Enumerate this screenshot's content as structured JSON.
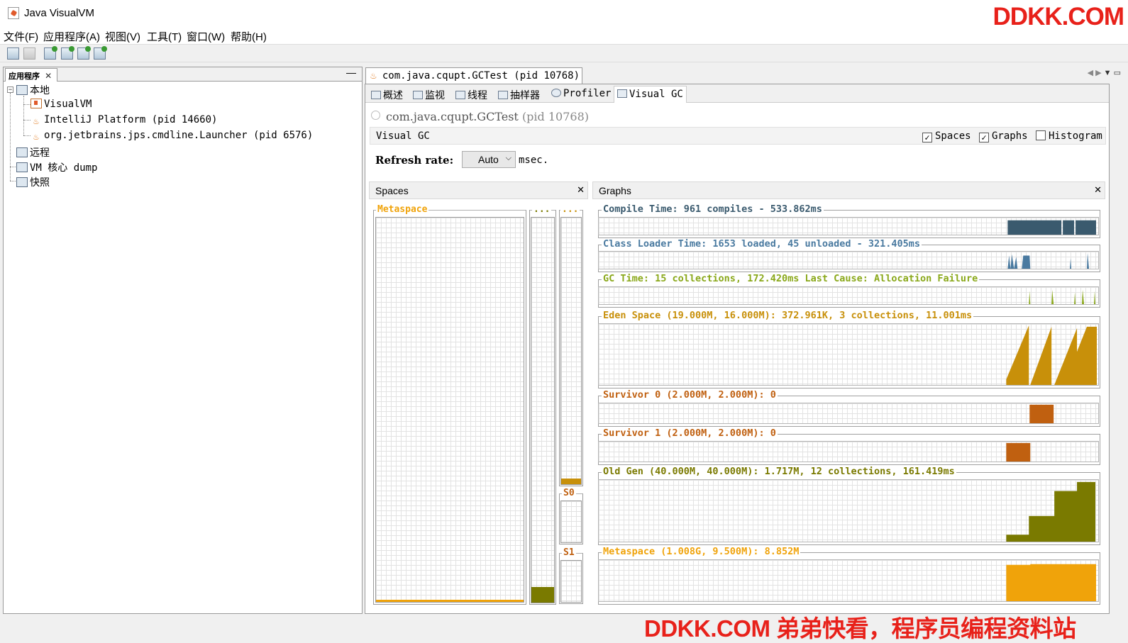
{
  "window": {
    "title": "Java VisualVM"
  },
  "watermark": {
    "top": "DDKK.COM",
    "bottom": "DDKK.COM 弟弟快看，程序员编程资料站"
  },
  "menu": [
    "文件(F)",
    "应用程序(A)",
    "视图(V)",
    "工具(T)",
    "窗口(W)",
    "帮助(H)"
  ],
  "left_panel": {
    "tab_label": "应用程序",
    "tree": {
      "local": "本地",
      "local_children": [
        "VisualVM",
        "IntelliJ Platform (pid 14660)",
        "org.jetbrains.jps.cmdline.Launcher (pid 6576)"
      ],
      "remote": "远程",
      "vm_dump": "VM 核心 dump",
      "snapshots": "快照"
    }
  },
  "document_tab": {
    "label": "com.java.cqupt.GCTest (pid 10768)"
  },
  "subtabs": [
    "概述",
    "监视",
    "线程",
    "抽样器",
    "Profiler",
    "Visual GC"
  ],
  "visual_gc": {
    "process_name": "com.java.cqupt.GCTest",
    "process_pid": "(pid 10768)",
    "bar_label": "Visual GC",
    "options": [
      {
        "label": "Spaces",
        "checked": true
      },
      {
        "label": "Graphs",
        "checked": true
      },
      {
        "label": "Histogram",
        "checked": false
      }
    ],
    "check_mark": "✓",
    "refresh_label": "Refresh rate:",
    "refresh_value": "Auto",
    "refresh_unit": "msec."
  },
  "spaces_pane": {
    "title": "Spaces",
    "metaspace_label": "Metaspace",
    "col2_label": "...",
    "col3_label": "...",
    "s0_label": "S0",
    "s1_label": "S1",
    "colors": {
      "meta": "#f0a30a",
      "old": "#7a7a00",
      "eden": "#c8900a"
    }
  },
  "graphs_pane": {
    "title": "Graphs",
    "graphs": [
      {
        "title": "Compile Time: 961 compiles - 533.862ms",
        "color": "#3a5a6e"
      },
      {
        "title": "Class Loader Time: 1653 loaded, 45 unloaded - 321.405ms",
        "color": "#4a7aa0"
      },
      {
        "title": "GC Time: 15 collections, 172.420ms Last Cause: Allocation Failure",
        "color": "#8aa81a"
      },
      {
        "title": "Eden Space (19.000M, 16.000M): 372.961K, 3 collections, 11.001ms",
        "color": "#c8900a"
      },
      {
        "title": "Survivor 0 (2.000M, 2.000M): 0",
        "color": "#c06010"
      },
      {
        "title": "Survivor 1 (2.000M, 2.000M): 0",
        "color": "#c06010"
      },
      {
        "title": "Old Gen (40.000M, 40.000M): 1.717M, 12 collections, 161.419ms",
        "color": "#7a7a00"
      },
      {
        "title": "Metaspace (1.008G, 9.500M): 8.852M",
        "color": "#f0a30a"
      }
    ]
  }
}
